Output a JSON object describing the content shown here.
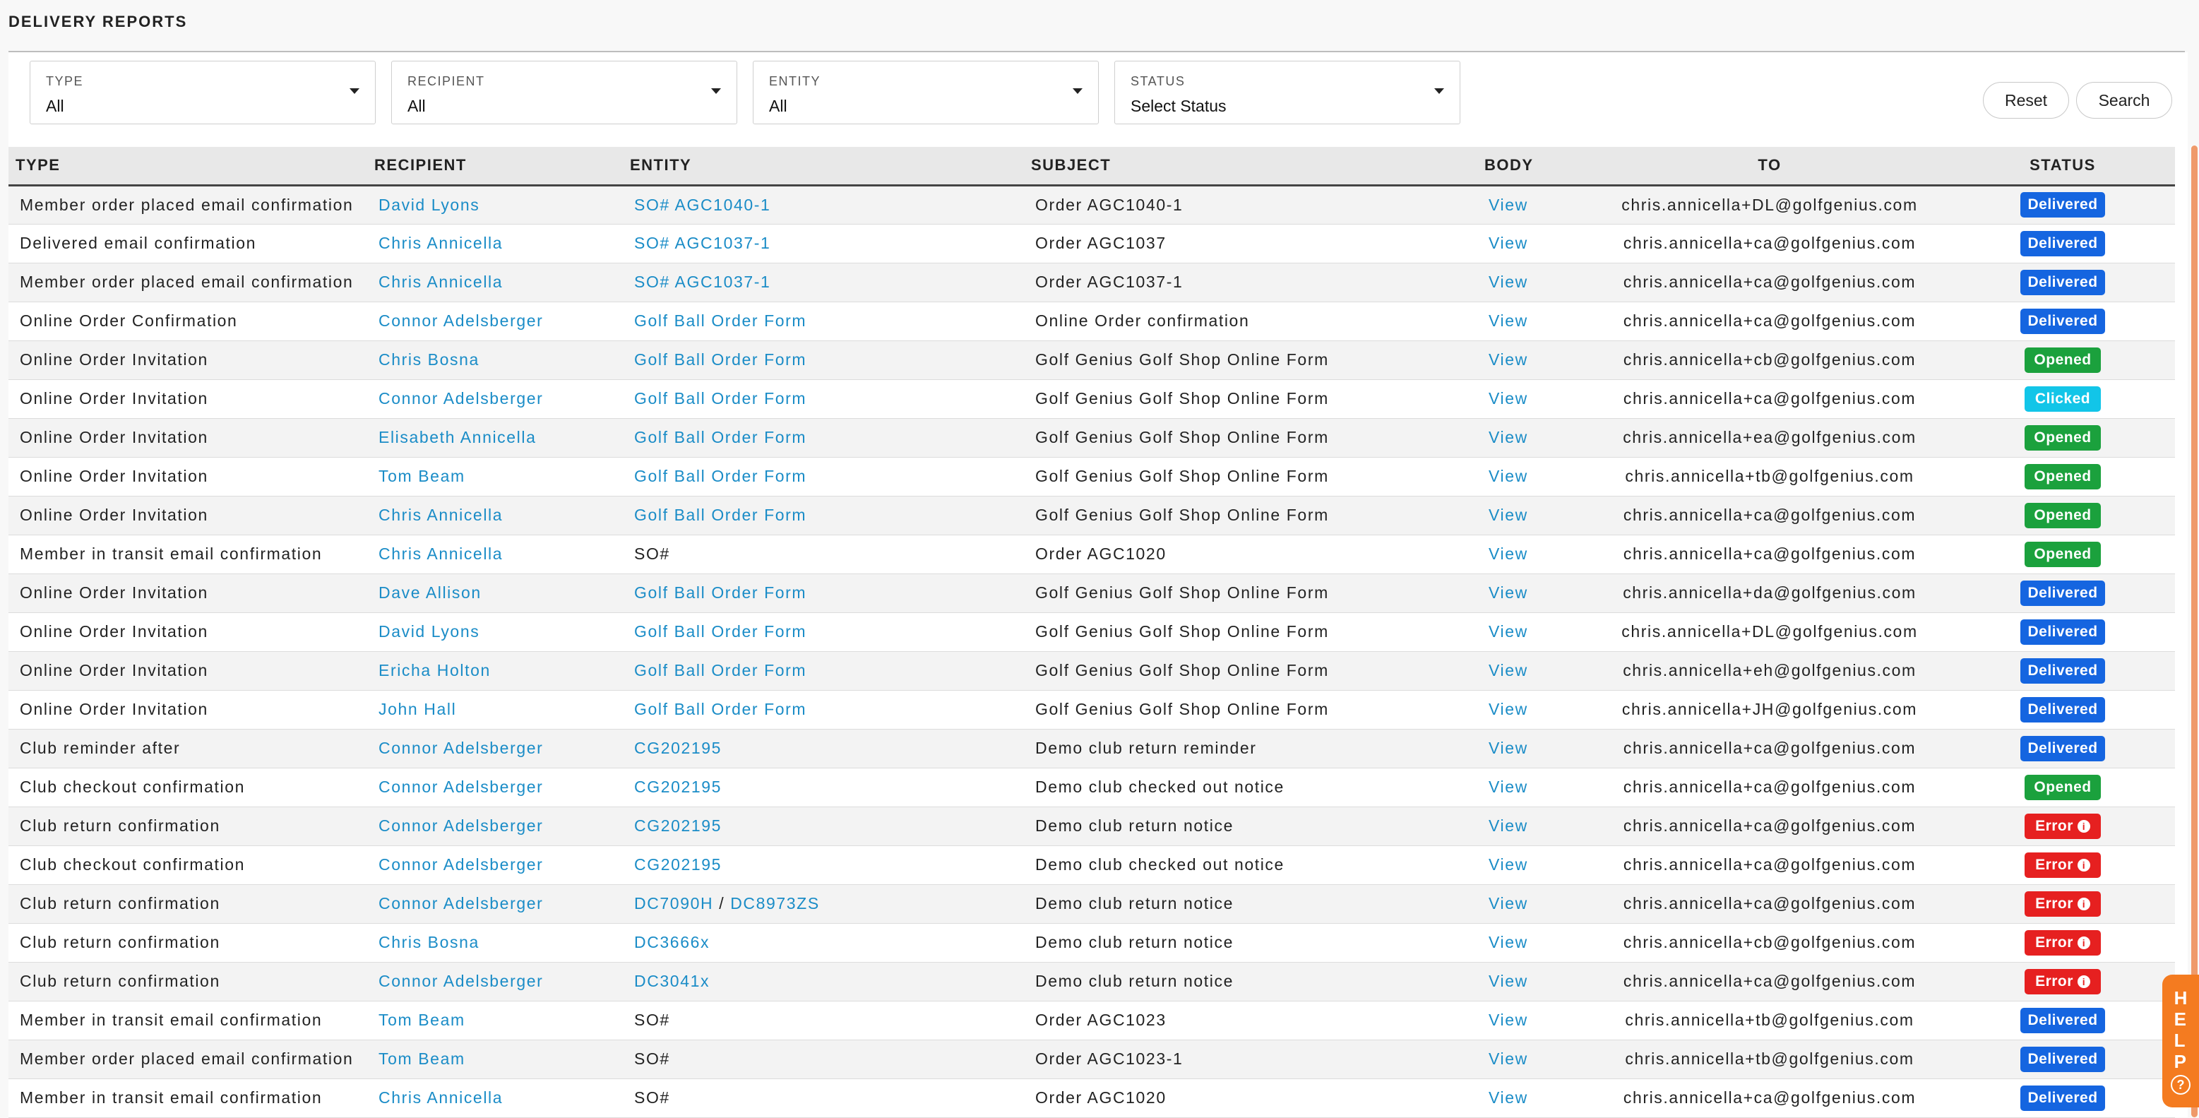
{
  "page_title": "DELIVERY REPORTS",
  "filters": [
    {
      "label": "TYPE",
      "value": "All"
    },
    {
      "label": "RECIPIENT",
      "value": "All"
    },
    {
      "label": "ENTITY",
      "value": "All"
    },
    {
      "label": "STATUS",
      "value": "Select Status"
    }
  ],
  "buttons": {
    "reset": "Reset",
    "search": "Search"
  },
  "columns": {
    "type": "TYPE",
    "recipient": "RECIPIENT",
    "entity": "ENTITY",
    "subject": "SUBJECT",
    "body": "BODY",
    "to": "TO",
    "status": "STATUS"
  },
  "status_colors": {
    "Delivered": "#1565e0",
    "Opened": "#1ba13d",
    "Clicked": "#12c5e8",
    "Error": "#e62020"
  },
  "help_label": "HELP",
  "rows": [
    {
      "type": "Member order placed email confirmation",
      "recipient": "David Lyons",
      "entity": [
        {
          "text": "SO# AGC1040-1",
          "link": true
        }
      ],
      "subject": "Order AGC1040-1",
      "body": "View",
      "to": "chris.annicella+DL@golfgenius.com",
      "status": "Delivered"
    },
    {
      "type": "Delivered email confirmation",
      "recipient": "Chris Annicella",
      "entity": [
        {
          "text": "SO# AGC1037-1",
          "link": true
        }
      ],
      "subject": "Order AGC1037",
      "body": "View",
      "to": "chris.annicella+ca@golfgenius.com",
      "status": "Delivered"
    },
    {
      "type": "Member order placed email confirmation",
      "recipient": "Chris Annicella",
      "entity": [
        {
          "text": "SO# AGC1037-1",
          "link": true
        }
      ],
      "subject": "Order AGC1037-1",
      "body": "View",
      "to": "chris.annicella+ca@golfgenius.com",
      "status": "Delivered"
    },
    {
      "type": "Online Order Confirmation",
      "recipient": "Connor Adelsberger",
      "entity": [
        {
          "text": "Golf Ball Order Form",
          "link": true
        }
      ],
      "subject": "Online Order confirmation",
      "body": "View",
      "to": "chris.annicella+ca@golfgenius.com",
      "status": "Delivered"
    },
    {
      "type": "Online Order Invitation",
      "recipient": "Chris Bosna",
      "entity": [
        {
          "text": "Golf Ball Order Form",
          "link": true
        }
      ],
      "subject": "Golf Genius Golf Shop Online Form",
      "body": "View",
      "to": "chris.annicella+cb@golfgenius.com",
      "status": "Opened"
    },
    {
      "type": "Online Order Invitation",
      "recipient": "Connor Adelsberger",
      "entity": [
        {
          "text": "Golf Ball Order Form",
          "link": true
        }
      ],
      "subject": "Golf Genius Golf Shop Online Form",
      "body": "View",
      "to": "chris.annicella+ca@golfgenius.com",
      "status": "Clicked"
    },
    {
      "type": "Online Order Invitation",
      "recipient": "Elisabeth Annicella",
      "entity": [
        {
          "text": "Golf Ball Order Form",
          "link": true
        }
      ],
      "subject": "Golf Genius Golf Shop Online Form",
      "body": "View",
      "to": "chris.annicella+ea@golfgenius.com",
      "status": "Opened"
    },
    {
      "type": "Online Order Invitation",
      "recipient": "Tom Beam",
      "entity": [
        {
          "text": "Golf Ball Order Form",
          "link": true
        }
      ],
      "subject": "Golf Genius Golf Shop Online Form",
      "body": "View",
      "to": "chris.annicella+tb@golfgenius.com",
      "status": "Opened"
    },
    {
      "type": "Online Order Invitation",
      "recipient": "Chris Annicella",
      "entity": [
        {
          "text": "Golf Ball Order Form",
          "link": true
        }
      ],
      "subject": "Golf Genius Golf Shop Online Form",
      "body": "View",
      "to": "chris.annicella+ca@golfgenius.com",
      "status": "Opened"
    },
    {
      "type": "Member in transit email confirmation",
      "recipient": "Chris Annicella",
      "entity": [
        {
          "text": "SO#",
          "link": false
        }
      ],
      "subject": "Order AGC1020",
      "body": "View",
      "to": "chris.annicella+ca@golfgenius.com",
      "status": "Opened"
    },
    {
      "type": "Online Order Invitation",
      "recipient": "Dave Allison",
      "entity": [
        {
          "text": "Golf Ball Order Form",
          "link": true
        }
      ],
      "subject": "Golf Genius Golf Shop Online Form",
      "body": "View",
      "to": "chris.annicella+da@golfgenius.com",
      "status": "Delivered"
    },
    {
      "type": "Online Order Invitation",
      "recipient": "David Lyons",
      "entity": [
        {
          "text": "Golf Ball Order Form",
          "link": true
        }
      ],
      "subject": "Golf Genius Golf Shop Online Form",
      "body": "View",
      "to": "chris.annicella+DL@golfgenius.com",
      "status": "Delivered"
    },
    {
      "type": "Online Order Invitation",
      "recipient": "Ericha Holton",
      "entity": [
        {
          "text": "Golf Ball Order Form",
          "link": true
        }
      ],
      "subject": "Golf Genius Golf Shop Online Form",
      "body": "View",
      "to": "chris.annicella+eh@golfgenius.com",
      "status": "Delivered"
    },
    {
      "type": "Online Order Invitation",
      "recipient": "John Hall",
      "entity": [
        {
          "text": "Golf Ball Order Form",
          "link": true
        }
      ],
      "subject": "Golf Genius Golf Shop Online Form",
      "body": "View",
      "to": "chris.annicella+JH@golfgenius.com",
      "status": "Delivered"
    },
    {
      "type": "Club reminder after",
      "recipient": "Connor Adelsberger",
      "entity": [
        {
          "text": "CG202195",
          "link": true
        }
      ],
      "subject": "Demo club return reminder",
      "body": "View",
      "to": "chris.annicella+ca@golfgenius.com",
      "status": "Delivered"
    },
    {
      "type": "Club checkout confirmation",
      "recipient": "Connor Adelsberger",
      "entity": [
        {
          "text": "CG202195",
          "link": true
        }
      ],
      "subject": "Demo club checked out notice",
      "body": "View",
      "to": "chris.annicella+ca@golfgenius.com",
      "status": "Opened"
    },
    {
      "type": "Club return confirmation",
      "recipient": "Connor Adelsberger",
      "entity": [
        {
          "text": "CG202195",
          "link": true
        }
      ],
      "subject": "Demo club return notice",
      "body": "View",
      "to": "chris.annicella+ca@golfgenius.com",
      "status": "Error"
    },
    {
      "type": "Club checkout confirmation",
      "recipient": "Connor Adelsberger",
      "entity": [
        {
          "text": "CG202195",
          "link": true
        }
      ],
      "subject": "Demo club checked out notice",
      "body": "View",
      "to": "chris.annicella+ca@golfgenius.com",
      "status": "Error"
    },
    {
      "type": "Club return confirmation",
      "recipient": "Connor Adelsberger",
      "entity": [
        {
          "text": "DC7090H",
          "link": true
        },
        {
          "text": " / ",
          "link": false
        },
        {
          "text": "DC8973ZS",
          "link": true
        }
      ],
      "subject": "Demo club return notice",
      "body": "View",
      "to": "chris.annicella+ca@golfgenius.com",
      "status": "Error"
    },
    {
      "type": "Club return confirmation",
      "recipient": "Chris Bosna",
      "entity": [
        {
          "text": "DC3666x",
          "link": true
        }
      ],
      "subject": "Demo club return notice",
      "body": "View",
      "to": "chris.annicella+cb@golfgenius.com",
      "status": "Error"
    },
    {
      "type": "Club return confirmation",
      "recipient": "Connor Adelsberger",
      "entity": [
        {
          "text": "DC3041x",
          "link": true
        }
      ],
      "subject": "Demo club return notice",
      "body": "View",
      "to": "chris.annicella+ca@golfgenius.com",
      "status": "Error"
    },
    {
      "type": "Member in transit email confirmation",
      "recipient": "Tom Beam",
      "entity": [
        {
          "text": "SO#",
          "link": false
        }
      ],
      "subject": "Order AGC1023",
      "body": "View",
      "to": "chris.annicella+tb@golfgenius.com",
      "status": "Delivered"
    },
    {
      "type": "Member order placed email confirmation",
      "recipient": "Tom Beam",
      "entity": [
        {
          "text": "SO#",
          "link": false
        }
      ],
      "subject": "Order AGC1023-1",
      "body": "View",
      "to": "chris.annicella+tb@golfgenius.com",
      "status": "Delivered"
    },
    {
      "type": "Member in transit email confirmation",
      "recipient": "Chris Annicella",
      "entity": [
        {
          "text": "SO#",
          "link": false
        }
      ],
      "subject": "Order AGC1020",
      "body": "View",
      "to": "chris.annicella+ca@golfgenius.com",
      "status": "Delivered"
    }
  ]
}
